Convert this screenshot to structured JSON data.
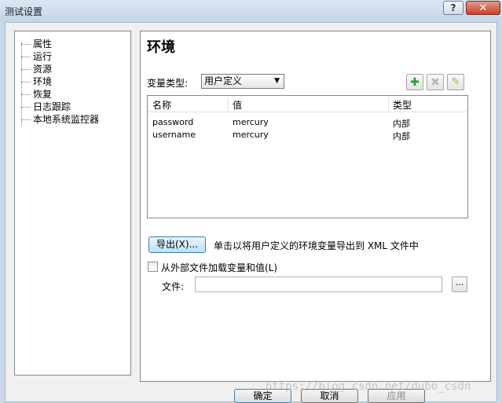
{
  "window": {
    "title": "测试设置",
    "help_glyph": "?",
    "close_glyph": "✕"
  },
  "tree": {
    "items": [
      {
        "label": "属性"
      },
      {
        "label": "运行"
      },
      {
        "label": "资源"
      },
      {
        "label": "环境"
      },
      {
        "label": "恢复"
      },
      {
        "label": "日志跟踪"
      },
      {
        "label": "本地系统监控器"
      }
    ]
  },
  "panel": {
    "title": "环境",
    "variable_type_label": "变量类型:",
    "variable_type_value": "用户定义",
    "select_arrow": "▼",
    "add_glyph": "✚",
    "delete_glyph": "✖",
    "edit_glyph": "✎",
    "table": {
      "columns": [
        "名称",
        "值",
        "类型"
      ],
      "rows": [
        [
          "password",
          "mercury",
          "内部"
        ],
        [
          "username",
          "mercury",
          "内部"
        ]
      ]
    },
    "export_button": "导出(X)...",
    "export_description": "单击以将用户定义的环境变量导出到 XML 文件中",
    "load_checkbox_label": "从外部文件加载变量和值(L)",
    "file_label": "文件:",
    "file_value": "",
    "browse_label": "..."
  },
  "buttons": {
    "ok": "确定",
    "cancel": "取消",
    "apply": "应用"
  },
  "watermark": "https://blog.csdn.net/dubo_csdn"
}
